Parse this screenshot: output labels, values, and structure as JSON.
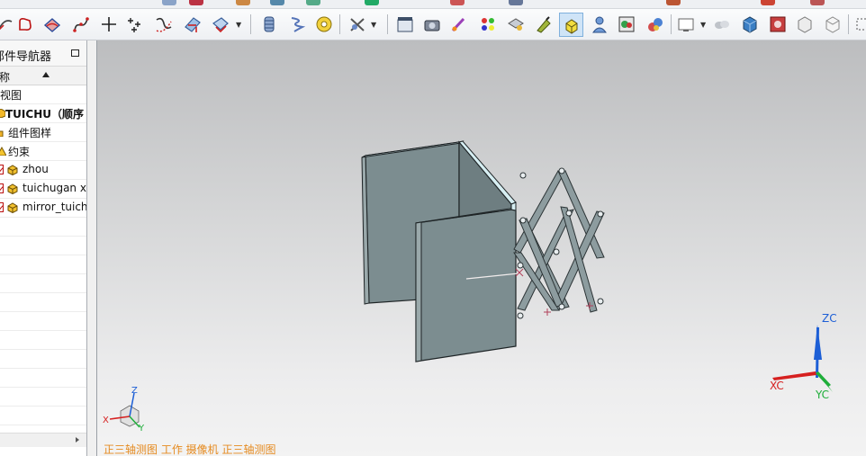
{
  "navigator": {
    "title": "部件导航器",
    "column_header": "名称",
    "rows": [
      {
        "label": "模型视图",
        "bold": false
      },
      {
        "label": "TUICHU（顺序",
        "bold": true
      },
      {
        "label": "组件图样",
        "bold": false
      },
      {
        "label": "约束",
        "bold": false
      },
      {
        "label": "zhou",
        "bold": false
      },
      {
        "label": "tuichugan x",
        "bold": false
      },
      {
        "label": "mirror_tuich",
        "bold": false
      }
    ]
  },
  "viewport": {
    "orientation_status": "正三轴测图 工作 摄像机 正三轴测图",
    "wcs_axes": {
      "x": "XC",
      "y": "YC",
      "z": "ZC"
    },
    "mini_triad": {
      "x": "X",
      "y": "Y",
      "z": "Z"
    }
  },
  "colors": {
    "model_face": "#7a8b8e",
    "model_edge": "#1e2426",
    "model_top": "#d6eef2",
    "status_text": "#e58a1f",
    "zc_axis": "#1d5fd6",
    "xc_axis": "#d62020",
    "yc_axis": "#1fae3a"
  },
  "toolbar": {
    "icons": [
      "mirror-curve-icon",
      "offset-curve-icon",
      "edit-curve-icon",
      "spline-icon",
      "point-icon",
      "point-set-icon",
      "bridge-curve-icon",
      "intersection-curve-icon",
      "section-curve-icon",
      "spring-icon",
      "helix-icon",
      "tape-icon",
      "hide-show-icon",
      "movie-icon",
      "camera-icon",
      "paint-icon",
      "palette-icon",
      "material-icon",
      "studio-icon",
      "shade-active-icon",
      "user-icon",
      "render-icon",
      "spheres-icon",
      "view-menu-icon",
      "blob-icon",
      "cube-icon",
      "image-icon",
      "box-icon",
      "open-box-icon"
    ]
  }
}
